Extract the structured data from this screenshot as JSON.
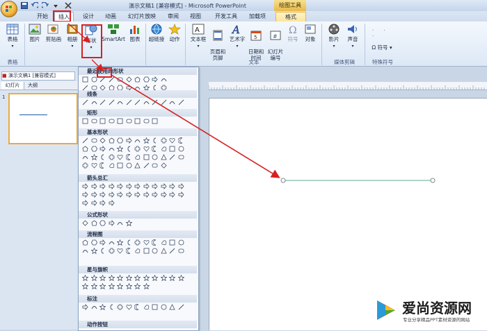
{
  "window": {
    "title": "演示文稿1 [兼容模式] - Microsoft PowerPoint",
    "context_tab_title": "绘图工具"
  },
  "tabs": [
    {
      "label": "开始"
    },
    {
      "label": "插入"
    },
    {
      "label": "设计"
    },
    {
      "label": "动画"
    },
    {
      "label": "幻灯片放映"
    },
    {
      "label": "审阅"
    },
    {
      "label": "视图"
    },
    {
      "label": "开发工具"
    },
    {
      "label": "加载项"
    },
    {
      "label": "格式"
    }
  ],
  "ribbon": {
    "buttons": {
      "table": "表格",
      "picture": "图片",
      "clipart": "剪贴画",
      "album": "相册",
      "shapes": "形状",
      "smartart": "SmartArt",
      "chart": "图表",
      "hyperlink": "超链接",
      "action": "动作",
      "textbox": "文本框",
      "header_footer": "页眉和\n页脚",
      "wordart": "艺术字",
      "datetime": "日期和\n时间",
      "slide_number": "幻灯片\n编号",
      "symbol": "符号",
      "object": "对象",
      "movie": "影片",
      "sound": "声音",
      "symbol2": "符号"
    },
    "groups": {
      "tables": "表格",
      "text": "文本",
      "media": "媒体剪辑",
      "special": "特殊符号"
    }
  },
  "left_pane": {
    "doc_tab": "演示文稿1 [兼容模式]",
    "tab_slides": "幻灯片",
    "tab_outline": "大纲",
    "slide_number": "1"
  },
  "gallery": {
    "sections": {
      "recent": "最近使用的形状",
      "lines": "线条",
      "rect": "矩形",
      "basic": "基本形状",
      "arrows": "箭头总汇",
      "equation": "公式形状",
      "flowchart": "流程图",
      "stars": "星与旗帜",
      "callouts": "标注",
      "action": "动作按钮"
    }
  },
  "watermark": {
    "title": "爱尚资源网",
    "subtitle": "专业分享精品PPT素材资源的网站"
  },
  "colors": {
    "highlight": "#d62020",
    "line_shape": "#7fb7a6"
  }
}
